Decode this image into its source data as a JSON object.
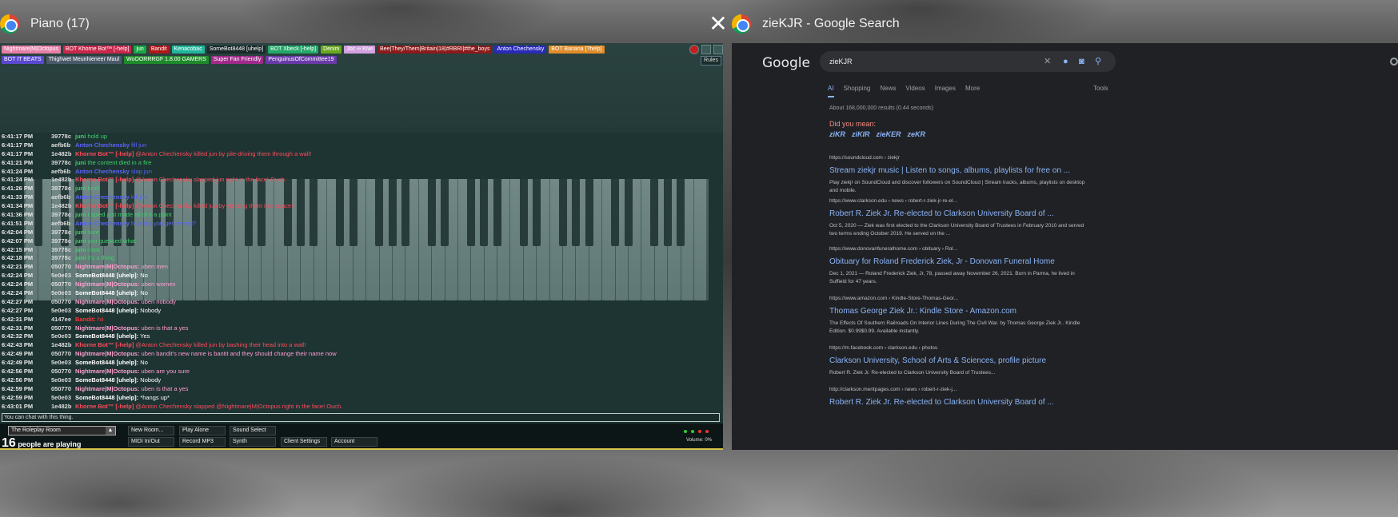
{
  "left_window": {
    "title": "Piano (17)",
    "tags_row1": [
      {
        "text": "Nightmare|M|Octopus",
        "color": "#e57fa6"
      },
      {
        "text": "BOT Khorne Bot™ [-help]",
        "color": "#c9264a"
      },
      {
        "text": "jun",
        "color": "#1aa544"
      },
      {
        "text": "Bandit",
        "color": "#b01818"
      },
      {
        "text": "Kenacobac",
        "color": "#21b59c"
      },
      {
        "text": "SomeBot8448 [uhelp]",
        "color": "#1a2a2a"
      },
      {
        "text": "BOT Xbeck [-help]",
        "color": "#24a86a"
      },
      {
        "text": "Denim",
        "color": "#6aa820"
      },
      {
        "text": "Joc ∞ Kiwi",
        "color": "#d3a0e0"
      },
      {
        "text": "Bee|They/Them|Britain|18|#RBRI|#the_boys",
        "color": "#8c1a1a"
      },
      {
        "text": "Anton Chechensky",
        "color": "#2a2ab8"
      },
      {
        "text": "BOT Banana [?help]",
        "color": "#e08c2a"
      }
    ],
    "tags_row2": [
      {
        "text": "BOT IT BEATS",
        "color": "#5a4ad0"
      },
      {
        "text": "Thighwet Meunhieneer  Maul",
        "color": "#4a5a6a"
      },
      {
        "text": "WoOORRRGF 1.8.00 GAMERS",
        "color": "#1e8a2a"
      },
      {
        "text": "Super Fan Friendly",
        "color": "#a02a8a"
      },
      {
        "text": "PenguinusOfCommittee19",
        "color": "#6a3aa8"
      }
    ],
    "rules": "Rules",
    "chat": [
      {
        "time": "6:41:17 PM",
        "id": "39778c",
        "name": "juni",
        "msg": "hold up",
        "color": "#3fd16a"
      },
      {
        "time": "6:41:17 PM",
        "id": "aefb6b",
        "name": "Anton Chechensky",
        "msg": "fill jun",
        "color": "#5b63ff"
      },
      {
        "time": "6:41:17 PM",
        "id": "1e482b",
        "name": "Khorne Bot™ [-help]",
        "msg": "@Anton Chechensky killed jun by pile-driving them through a wall!",
        "color": "#ff4a5a"
      },
      {
        "time": "6:41:21 PM",
        "id": "39778c",
        "name": "juni",
        "msg": "the content died in a fire",
        "color": "#3fd16a"
      },
      {
        "time": "6:41:24 PM",
        "id": "aefb6b",
        "name": "Anton Chechensky",
        "msg": "slap jun",
        "color": "#5b63ff"
      },
      {
        "time": "6:41:24 PM",
        "id": "1e482b",
        "name": "Khorne Bot™ [-help]",
        "msg": "@Anton Chechensky slapped jun right in the face! Ouch.",
        "color": "#ff4a5a"
      },
      {
        "time": "6:41:26 PM",
        "id": "39778c",
        "name": "juni",
        "msg": "bruh",
        "color": "#3fd16a"
      },
      {
        "time": "6:41:33 PM",
        "id": "aefb6b",
        "name": "Anton Chechensky",
        "msg": "kill jun",
        "color": "#5b63ff"
      },
      {
        "time": "6:41:34 PM",
        "id": "1e482b",
        "name": "Khorne Bot™ [-help]",
        "msg": "@Anton Chechensky killed jun by ejecting them into space!",
        "color": "#ff4a5a"
      },
      {
        "time": "6:41:36 PM",
        "id": "39778c",
        "name": "juni",
        "msg": "I spied just made all of it a point",
        "color": "#3fd16a"
      },
      {
        "time": "6:41:51 PM",
        "id": "aefb6b",
        "name": "Anton Chechensky",
        "msg": "how did you get owned?",
        "color": "#5b63ff"
      },
      {
        "time": "6:42:04 PM",
        "id": "39778c",
        "name": "juni",
        "msg": "sure",
        "color": "#3fd16a"
      },
      {
        "time": "6:42:07 PM",
        "id": "39778c",
        "name": "juni",
        "msg": "you guessed what",
        "color": "#3fd16a"
      },
      {
        "time": "6:42:15 PM",
        "id": "39778c",
        "name": "juni",
        "msg": "i lost",
        "color": "#3fd16a"
      },
      {
        "time": "6:42:18 PM",
        "id": "39778c",
        "name": "juni",
        "msg": "it's a thing",
        "color": "#3fd16a"
      },
      {
        "time": "6:42:21 PM",
        "id": "050770",
        "name": "Nightmare|M|Octopus:",
        "msg": "uben men",
        "color": "#ff9fcf"
      },
      {
        "time": "6:42:24 PM",
        "id": "5e0e03",
        "name": "SomeBot8448 [uhelp]:",
        "msg": "No",
        "color": "#ffffff"
      },
      {
        "time": "6:42:24 PM",
        "id": "050770",
        "name": "Nightmare|M|Octopus:",
        "msg": "uben women",
        "color": "#ff9fcf"
      },
      {
        "time": "6:42:24 PM",
        "id": "5e0e03",
        "name": "SomeBot8448 [uhelp]:",
        "msg": "No",
        "color": "#ffffff"
      },
      {
        "time": "6:42:27 PM",
        "id": "050770",
        "name": "Nightmare|M|Octopus:",
        "msg": "uben nobody",
        "color": "#ff9fcf"
      },
      {
        "time": "6:42:27 PM",
        "id": "5e0e03",
        "name": "SomeBot8448 [uhelp]:",
        "msg": "Nobody",
        "color": "#ffffff"
      },
      {
        "time": "6:42:31 PM",
        "id": "4147ee",
        "name": "Bandit:",
        "msg": "hii",
        "color": "#ff3333"
      },
      {
        "time": "6:42:31 PM",
        "id": "050770",
        "name": "Nightmare|M|Octopus:",
        "msg": "uben is that a yes",
        "color": "#ff9fcf"
      },
      {
        "time": "6:42:32 PM",
        "id": "5e0e03",
        "name": "SomeBot8448 [uhelp]:",
        "msg": "Yes",
        "color": "#ffffff"
      },
      {
        "time": "6:42:43 PM",
        "id": "1e482b",
        "name": "Khorne Bot™ [-help]",
        "msg": "@Anton Chechensky killed jun by bashing their head into a wall!",
        "color": "#ff4a5a"
      },
      {
        "time": "6:42:49 PM",
        "id": "050770",
        "name": "Nightmare|M|Octopus:",
        "msg": "uben bandit's new name is bantit and they should change their name now",
        "color": "#ff9fcf"
      },
      {
        "time": "6:42:49 PM",
        "id": "5e0e03",
        "name": "SomeBot8448 [uhelp]:",
        "msg": "No",
        "color": "#ffffff"
      },
      {
        "time": "6:42:56 PM",
        "id": "050770",
        "name": "Nightmare|M|Octopus:",
        "msg": "uben are you sure",
        "color": "#ff9fcf"
      },
      {
        "time": "6:42:56 PM",
        "id": "5e0e03",
        "name": "SomeBot8448 [uhelp]:",
        "msg": "Nobody",
        "color": "#ffffff"
      },
      {
        "time": "6:42:59 PM",
        "id": "050770",
        "name": "Nightmare|M|Octopus:",
        "msg": "uben is that a yes",
        "color": "#ff9fcf"
      },
      {
        "time": "6:42:59 PM",
        "id": "5e0e03",
        "name": "SomeBot8448 [uhelp]:",
        "msg": "*hangs up*",
        "color": "#ffffff"
      },
      {
        "time": "6:43:01 PM",
        "id": "1e482b",
        "name": "Khorne Bot™ [-help]",
        "msg": "@Anton Chechensky slapped @Nightmare|M|Octopus right in the face! Ouch.",
        "color": "#ff4a5a"
      }
    ],
    "chat_placeholder": "You can chat with this thing.",
    "room": "The Roleplay Room",
    "players_count": "16",
    "players_text": "people are playing",
    "buttons": {
      "new_room": "New Room...",
      "play_alone": "Play Alone",
      "sound_select": "Sound Select",
      "midi": "MIDI In/Out",
      "record": "Record MP3",
      "synth": "Synth",
      "client_settings": "Client Settings",
      "account": "Account"
    },
    "volume": "Volume: 0%"
  },
  "right_window": {
    "title": "zieKJR - Google Search",
    "logo": "Google",
    "query": "zieKJR",
    "tabs": [
      "AI",
      "Shopping",
      "News",
      "Videos",
      "Images",
      "More"
    ],
    "tools": "Tools",
    "stats": "About 168,000,000 results (0.44 seconds)",
    "did_you_mean": "Did you mean:",
    "suggestions": [
      "ziKR",
      "ziKIR",
      "zieKER",
      "zeKR"
    ],
    "results": [
      {
        "url": "https://soundcloud.com › ziekjr",
        "title": "Stream ziekjr music | Listen to songs, albums, playlists for free on ...",
        "snippet": "Play ziekjr on SoundCloud and discover followers on SoundCloud | Stream tracks, albums, playlists on desktop and mobile."
      },
      {
        "url": "https://www.clarkson.edu › news › robert-r-ziek-jr-re-el...",
        "title": "Robert R. Ziek Jr. Re-elected to Clarkson University Board of ...",
        "snippet": "Oct 5, 2020 — Ziek was first elected to the Clarkson University Board of Trustees in February 2010 and served two terms ending October 2019. He served on the ..."
      },
      {
        "url": "https://www.donovanfuneralhome.com › obituary › Rol...",
        "title": "Obituary for Roland Frederick Ziek, Jr - Donovan Funeral Home",
        "snippet": "Dec 1, 2021 — Roland Frederick Ziek, Jr, 78, passed away November 26, 2021. Born in Parma, he lived in Suffield for 47 years."
      },
      {
        "url": "https://www.amazon.com › Kindle-Store-Thomas-Geor...",
        "title": "Thomas George Ziek Jr.: Kindle Store - Amazon.com",
        "snippet": "The Effects Of Southern Railroads On Interior Lines During The Civil War. by Thomas George Ziek Jr.. Kindle Edition. $0.99$0.99. Available instantly."
      },
      {
        "url": "https://m.facebook.com › clarkson.edu › photos",
        "title": "Clarkson University, School of Arts & Sciences, profile picture",
        "snippet": "Robert R. Ziek Jr. Re-elected to Clarkson University Board of Trustees..."
      },
      {
        "url": "http://clarkson.meritpages.com › news › robert-r-ziek-j...",
        "title": "Robert R. Ziek Jr. Re-elected to Clarkson University Board of ...",
        "snippet": ""
      }
    ]
  }
}
